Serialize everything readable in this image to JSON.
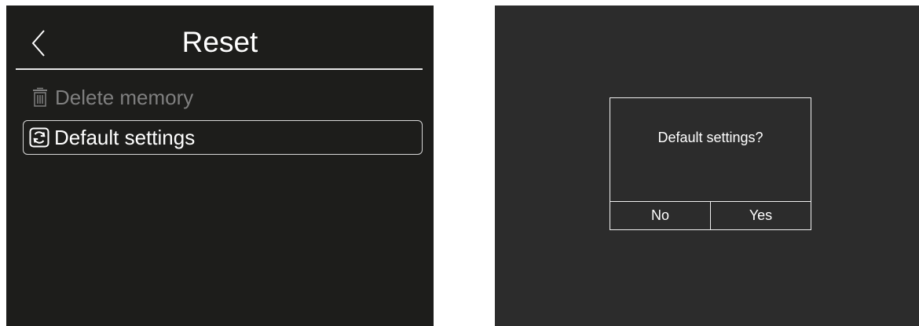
{
  "reset_menu": {
    "title": "Reset",
    "back_icon": "chevron-left-icon",
    "items": [
      {
        "label": "Delete memory",
        "icon": "trash-icon",
        "state": "disabled"
      },
      {
        "label": "Default settings",
        "icon": "refresh-icon",
        "state": "selected"
      }
    ]
  },
  "dialog": {
    "message": "Default settings?",
    "buttons": {
      "no": "No",
      "yes": "Yes"
    }
  },
  "colors": {
    "left_screen_bg": "#1d1d1b",
    "right_screen_bg": "#2c2c2c",
    "text_primary": "#ffffff",
    "text_disabled": "#7f7f7f"
  }
}
